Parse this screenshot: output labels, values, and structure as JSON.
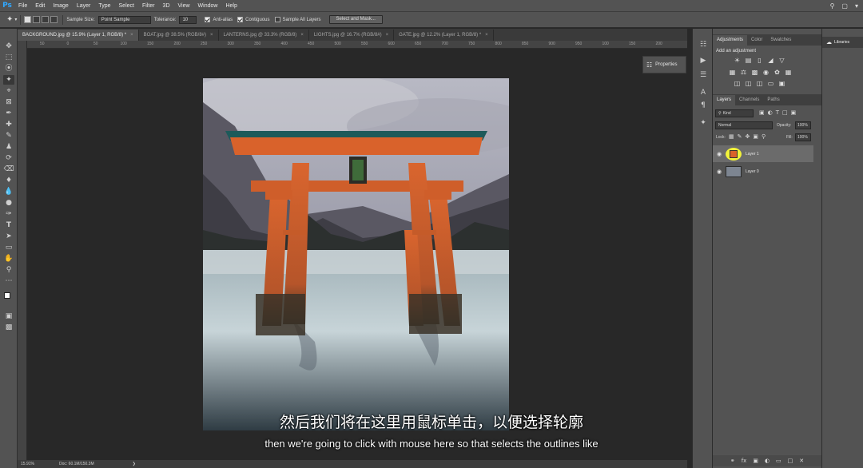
{
  "app": {
    "logo": "Ps"
  },
  "menu": {
    "items": [
      "File",
      "Edit",
      "Image",
      "Layer",
      "Type",
      "Select",
      "Filter",
      "3D",
      "View",
      "Window",
      "Help"
    ],
    "right_icons": [
      "search-icon",
      "workspace-icon"
    ]
  },
  "options_bar": {
    "sample_size_label": "Sample Size:",
    "sample_size_value": "Point Sample",
    "tolerance_label": "Tolerance:",
    "tolerance_value": "10",
    "anti_alias_label": "Anti-alias",
    "anti_alias_checked": true,
    "contiguous_label": "Contiguous",
    "contiguous_checked": true,
    "sample_all_layers_label": "Sample All Layers",
    "sample_all_layers_checked": false,
    "select_mask_label": "Select and Mask..."
  },
  "tabs": [
    {
      "label": "BACKGROUND.jpg @ 15.9% (Layer 1, RGB/8) *",
      "active": true
    },
    {
      "label": "BOAT.jpg @ 38.5% (RGB/8#)",
      "active": false
    },
    {
      "label": "LANTERNS.jpg @ 33.3% (RGB/8)",
      "active": false
    },
    {
      "label": "LIGHTS.jpg @ 16.7% (RGB/8#)",
      "active": false
    },
    {
      "label": "GATE.jpg @ 12.2% (Layer 1, RGB/8) *",
      "active": false
    }
  ],
  "ruler": {
    "ticks": [
      "50",
      "0",
      "50",
      "100",
      "150",
      "200",
      "250",
      "300",
      "350",
      "400",
      "450",
      "500",
      "550",
      "600",
      "650",
      "700",
      "750",
      "800",
      "850",
      "900",
      "950",
      "100",
      "150",
      "200"
    ]
  },
  "status": {
    "zoom": "15.91%",
    "doc": "Doc: 60.1M/150.3M"
  },
  "properties_button": {
    "label": "Properties"
  },
  "adjustments": {
    "tabs": [
      "Adjustments",
      "Color",
      "Swatches"
    ],
    "add_label": "Add an adjustment"
  },
  "layers_panel": {
    "tabs": [
      "Layers",
      "Channels",
      "Paths"
    ],
    "kind_label": "Kind",
    "blend_mode": "Normal",
    "opacity_label": "Opacity:",
    "opacity_value": "100%",
    "lock_label": "Lock:",
    "fill_label": "Fill:",
    "fill_value": "100%",
    "layers": [
      {
        "name": "Layer 1",
        "selected": true
      },
      {
        "name": "Layer 0",
        "selected": false
      }
    ]
  },
  "libraries": {
    "label": "Libraries"
  },
  "subtitles": {
    "zh": "然后我们将在这里用鼠标单击，以便选择轮廓",
    "en": "then we're going to click with mouse here so that selects the outlines like"
  },
  "colors": {
    "ui": "#535353",
    "canvas": "#282828",
    "torii": "#d9622b",
    "highlight": "#f2f23a"
  }
}
